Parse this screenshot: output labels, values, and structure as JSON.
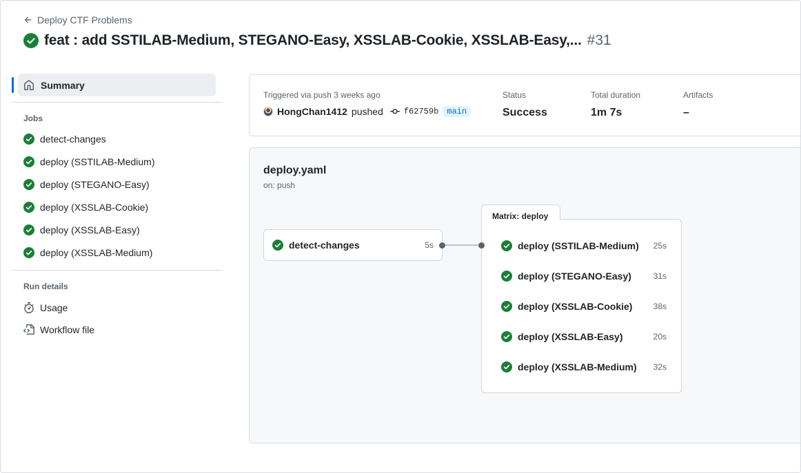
{
  "header": {
    "back_label": "Deploy CTF Problems",
    "title": "feat : add SSTILAB-Medium, STEGANO-Easy, XSSLAB-Cookie, XSSLAB-Easy,...",
    "run_number": "#31"
  },
  "sidebar": {
    "summary_label": "Summary",
    "jobs_heading": "Jobs",
    "jobs": [
      {
        "label": "detect-changes"
      },
      {
        "label": "deploy (SSTILAB-Medium)"
      },
      {
        "label": "deploy (STEGANO-Easy)"
      },
      {
        "label": "deploy (XSSLAB-Cookie)"
      },
      {
        "label": "deploy (XSSLAB-Easy)"
      },
      {
        "label": "deploy (XSSLAB-Medium)"
      }
    ],
    "run_details_heading": "Run details",
    "usage_label": "Usage",
    "workflow_file_label": "Workflow file"
  },
  "summary": {
    "trigger_label": "Triggered via push 3 weeks ago",
    "actor": "HongChan1412",
    "action": "pushed",
    "commit_sha": "f62759b",
    "branch": "main",
    "status_label": "Status",
    "status_value": "Success",
    "duration_label": "Total duration",
    "duration_value": "1m 7s",
    "artifacts_label": "Artifacts",
    "artifacts_value": "–"
  },
  "graph": {
    "workflow_file": "deploy.yaml",
    "trigger": "on: push",
    "first_job": {
      "name": "detect-changes",
      "duration": "5s"
    },
    "matrix_label": "Matrix: deploy",
    "matrix_jobs": [
      {
        "name": "deploy (SSTILAB-Medium)",
        "duration": "25s"
      },
      {
        "name": "deploy (STEGANO-Easy)",
        "duration": "31s"
      },
      {
        "name": "deploy (XSSLAB-Cookie)",
        "duration": "38s"
      },
      {
        "name": "deploy (XSSLAB-Easy)",
        "duration": "20s"
      },
      {
        "name": "deploy (XSSLAB-Medium)",
        "duration": "32s"
      }
    ]
  },
  "colors": {
    "success": "#1a7f37",
    "accent": "#0969da",
    "muted": "#59636e"
  }
}
